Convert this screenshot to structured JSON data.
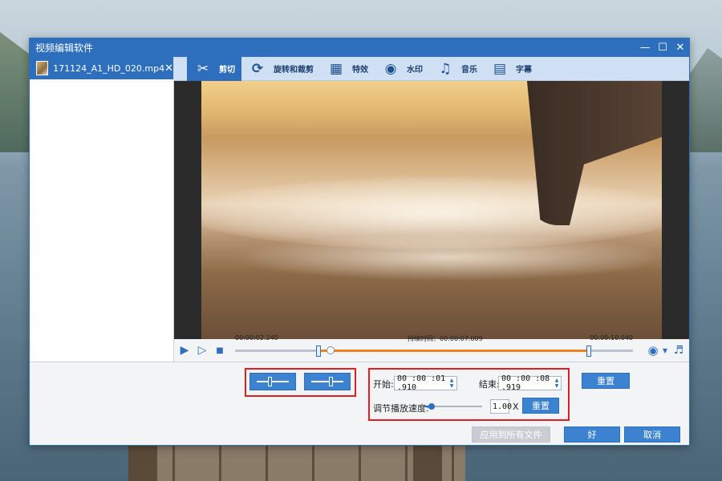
{
  "window": {
    "title": "视频编辑软件"
  },
  "file": {
    "name": "171124_A1_HD_020.mp4"
  },
  "tabs": [
    {
      "label": "剪切",
      "icon": "scissors-icon"
    },
    {
      "label": "旋转和裁剪",
      "icon": "crop-rotate-icon"
    },
    {
      "label": "特效",
      "icon": "effects-icon"
    },
    {
      "label": "水印",
      "icon": "watermark-icon"
    },
    {
      "label": "音乐",
      "icon": "music-icon"
    },
    {
      "label": "字幕",
      "icon": "subtitle-icon"
    }
  ],
  "timeline": {
    "start_time": "00:00:02.240",
    "duration_label": "持续时间：00:00:07.009",
    "end_time": "00:00:10.040",
    "sel_start": 0.21,
    "sel_end": 0.89,
    "playhead": 0.24
  },
  "trim": {
    "start_label": "开始:",
    "start_value": "00 :00 :01 .910",
    "end_label": "结束:",
    "end_value": "00 :00 :08 .919",
    "reset_label": "重置",
    "speed_label": "调节播放速度:",
    "speed_value": "1.00",
    "speed_unit": "X",
    "speed_fraction": 0.12,
    "speed_reset_label": "重置"
  },
  "footer": {
    "apply_all_label": "应用到所有文件",
    "ok_label": "好",
    "cancel_label": "取消"
  },
  "colors": {
    "accent": "#2d6ebd",
    "highlight": "#e02020",
    "progress": "#f0821e"
  }
}
